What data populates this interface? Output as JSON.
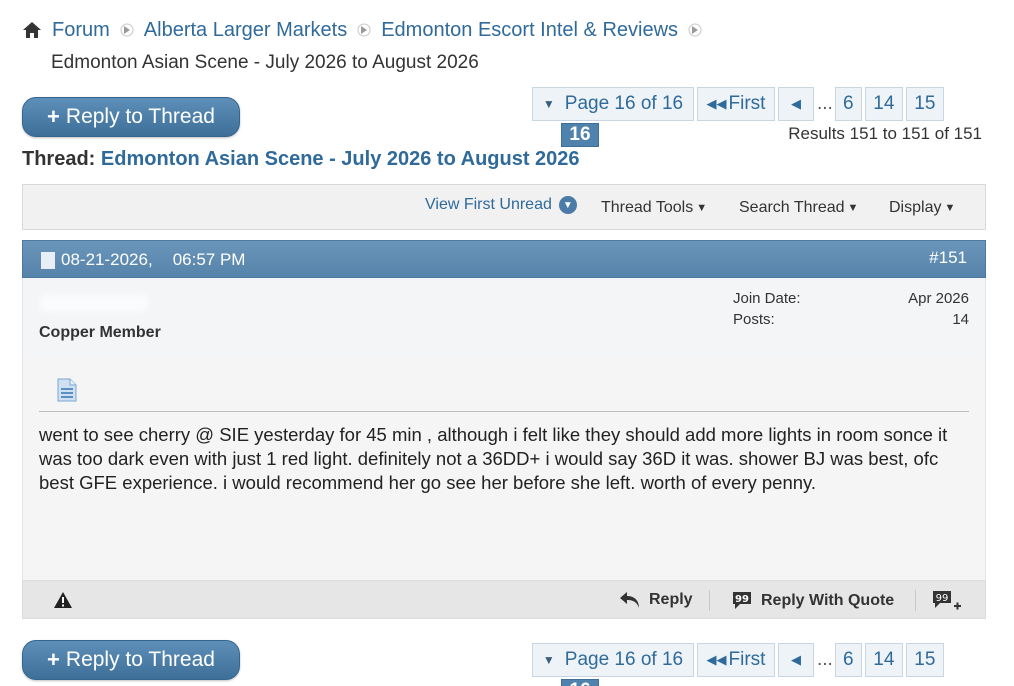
{
  "breadcrumb": {
    "items": [
      "Forum",
      "Alberta Larger Markets",
      "Edmonton Escort Intel & Reviews"
    ],
    "current": "Edmonton Asian Scene - July 2026 to August 2026"
  },
  "reply_button": {
    "plus": "+",
    "label": "Reply to Thread"
  },
  "pagination": {
    "dropdown_label": "Page 16 of 16",
    "first_label": "First",
    "prev_symbol": "◀",
    "ellipsis": "...",
    "pages": [
      "6",
      "14",
      "15",
      "16"
    ],
    "current_page": "16"
  },
  "results_text": "Results 151 to 151 of 151",
  "thread": {
    "prefix": "Thread:",
    "title": "Edmonton Asian Scene - July 2026 to August 2026"
  },
  "controls": {
    "view_first_unread": "View First Unread",
    "thread_tools": "Thread Tools",
    "search_thread": "Search Thread",
    "display": "Display"
  },
  "post": {
    "date": "08-21-2026,",
    "time": "06:57 PM",
    "number": "#151",
    "user_title": "Copper Member",
    "join_date_label": "Join Date:",
    "join_date_value": "Apr 2026",
    "posts_label": "Posts:",
    "posts_value": "14",
    "body": "went to see cherry @ SIE yesterday for 45 min , although i felt like they should add more lights in room sonce it was too dark even with just 1 red light. definitely not a 36DD+ i would say 36D it was. shower BJ was best, ofc best GFE experience. i would recommend her go see her before she left. worth of every penny.",
    "reply_label": "Reply",
    "reply_with_quote_label": "Reply With Quote"
  },
  "colors": {
    "link": "#2f6a9a",
    "post_header": "#5683aa",
    "current_page": "#4f82ac",
    "button": "#3d6f98"
  }
}
